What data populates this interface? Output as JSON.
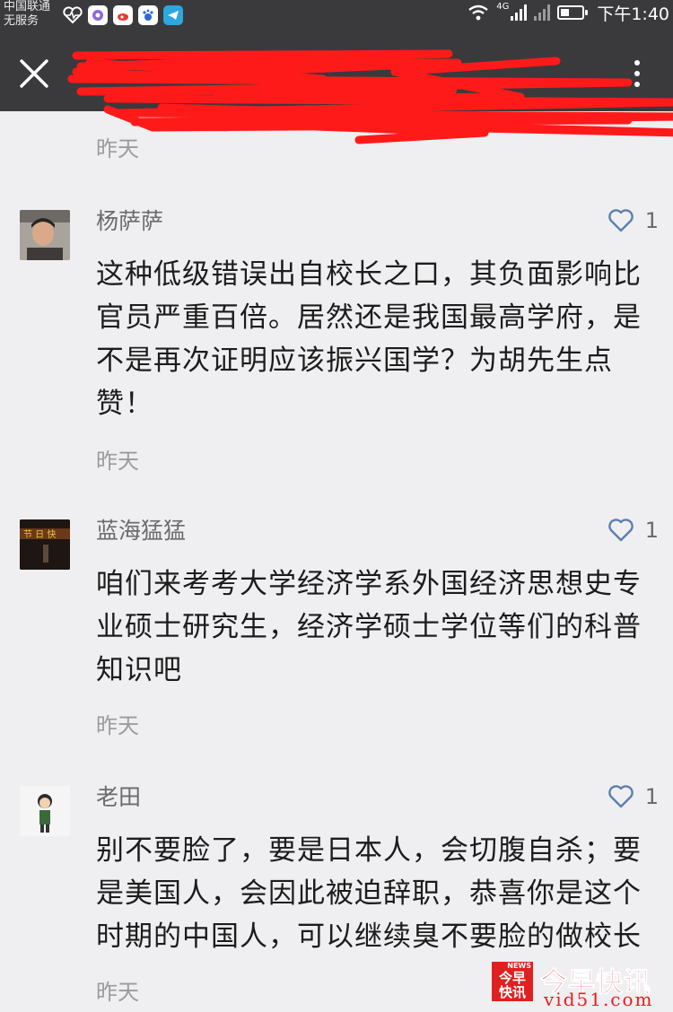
{
  "status_bar": {
    "carrier_line1": "中国联通",
    "carrier_line2": "无服务",
    "network": "4G",
    "time": "下午1:40"
  },
  "top_time": "昨天",
  "comments": [
    {
      "name": "杨萨萨",
      "likes": "1",
      "text": "这种低级错误出自校长之口，其负面影响比官员严重百倍。居然还是我国最高学府，是不是再次证明应该振兴国学？为胡先生点赞！",
      "time": "昨天"
    },
    {
      "name": "蓝海猛猛",
      "likes": "1",
      "text": "咱们来考考大学经济学系外国经济思想史专业硕士研究生，经济学硕士学位等们的科普知识吧",
      "time": "昨天"
    },
    {
      "name": "老田",
      "likes": "1",
      "text": "别不要脸了，要是日本人，会切腹自杀；要是美国人，会因此被迫辞职，恭喜你是这个时期的中国人，可以继续臭不要脸的做校长",
      "time": "昨天"
    }
  ],
  "watermark": {
    "badge_small": "NEWS",
    "badge": "今早快讯",
    "title": "今早快讯",
    "url": "vid51.com"
  },
  "colors": {
    "bar_bg": "#3a3a3c",
    "page_bg": "#efeff1",
    "heart": "#5a7fb0",
    "redaction": "#ff1a1a"
  }
}
